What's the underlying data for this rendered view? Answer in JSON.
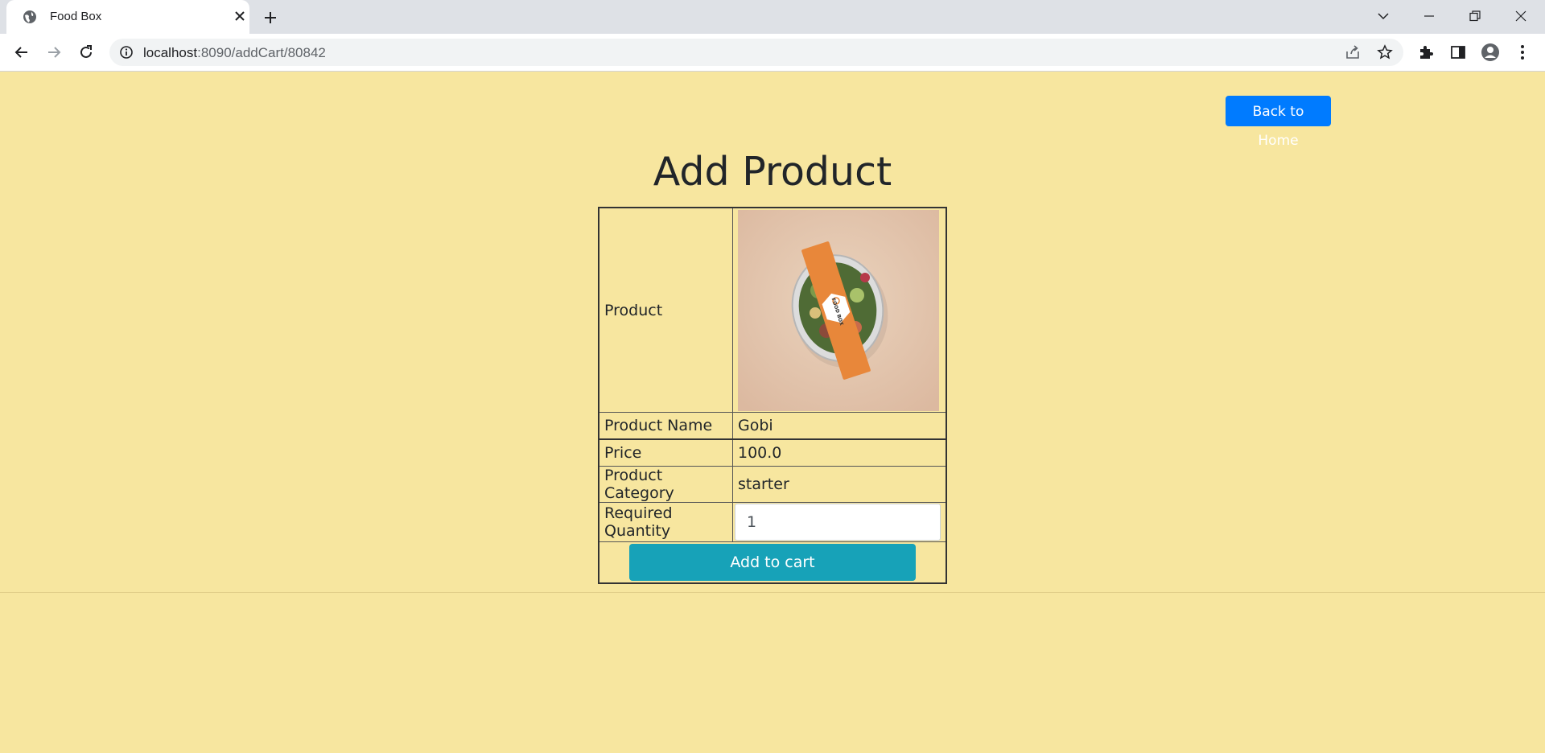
{
  "browser": {
    "tab_title": "Food Box",
    "url_host": "localhost",
    "url_path": ":8090/addCart/80842"
  },
  "page": {
    "back_home_label": "Back to Home",
    "heading": "Add Product",
    "rows": {
      "product_label": "Product",
      "name_label": "Product Name",
      "name_value": "Gobi",
      "price_label": "Price",
      "price_value": "100.0",
      "category_label": "Product Category",
      "category_value": "starter",
      "quantity_label": "Required Quantity",
      "quantity_value": "1"
    },
    "add_to_cart_label": "Add to cart",
    "image_brand_text": "FOOD BOX"
  },
  "colors": {
    "page_bg": "#f7e69f",
    "primary_button": "#007bff",
    "info_button": "#17a2b8"
  },
  "icons": [
    "globe-icon",
    "close-icon",
    "plus-icon",
    "chevron-down-icon",
    "minimize-icon",
    "restore-icon",
    "window-close-icon",
    "back-arrow-icon",
    "forward-arrow-icon",
    "reload-icon",
    "info-icon",
    "share-icon",
    "star-icon",
    "puzzle-icon",
    "side-panel-icon",
    "profile-icon",
    "more-vert-icon"
  ]
}
